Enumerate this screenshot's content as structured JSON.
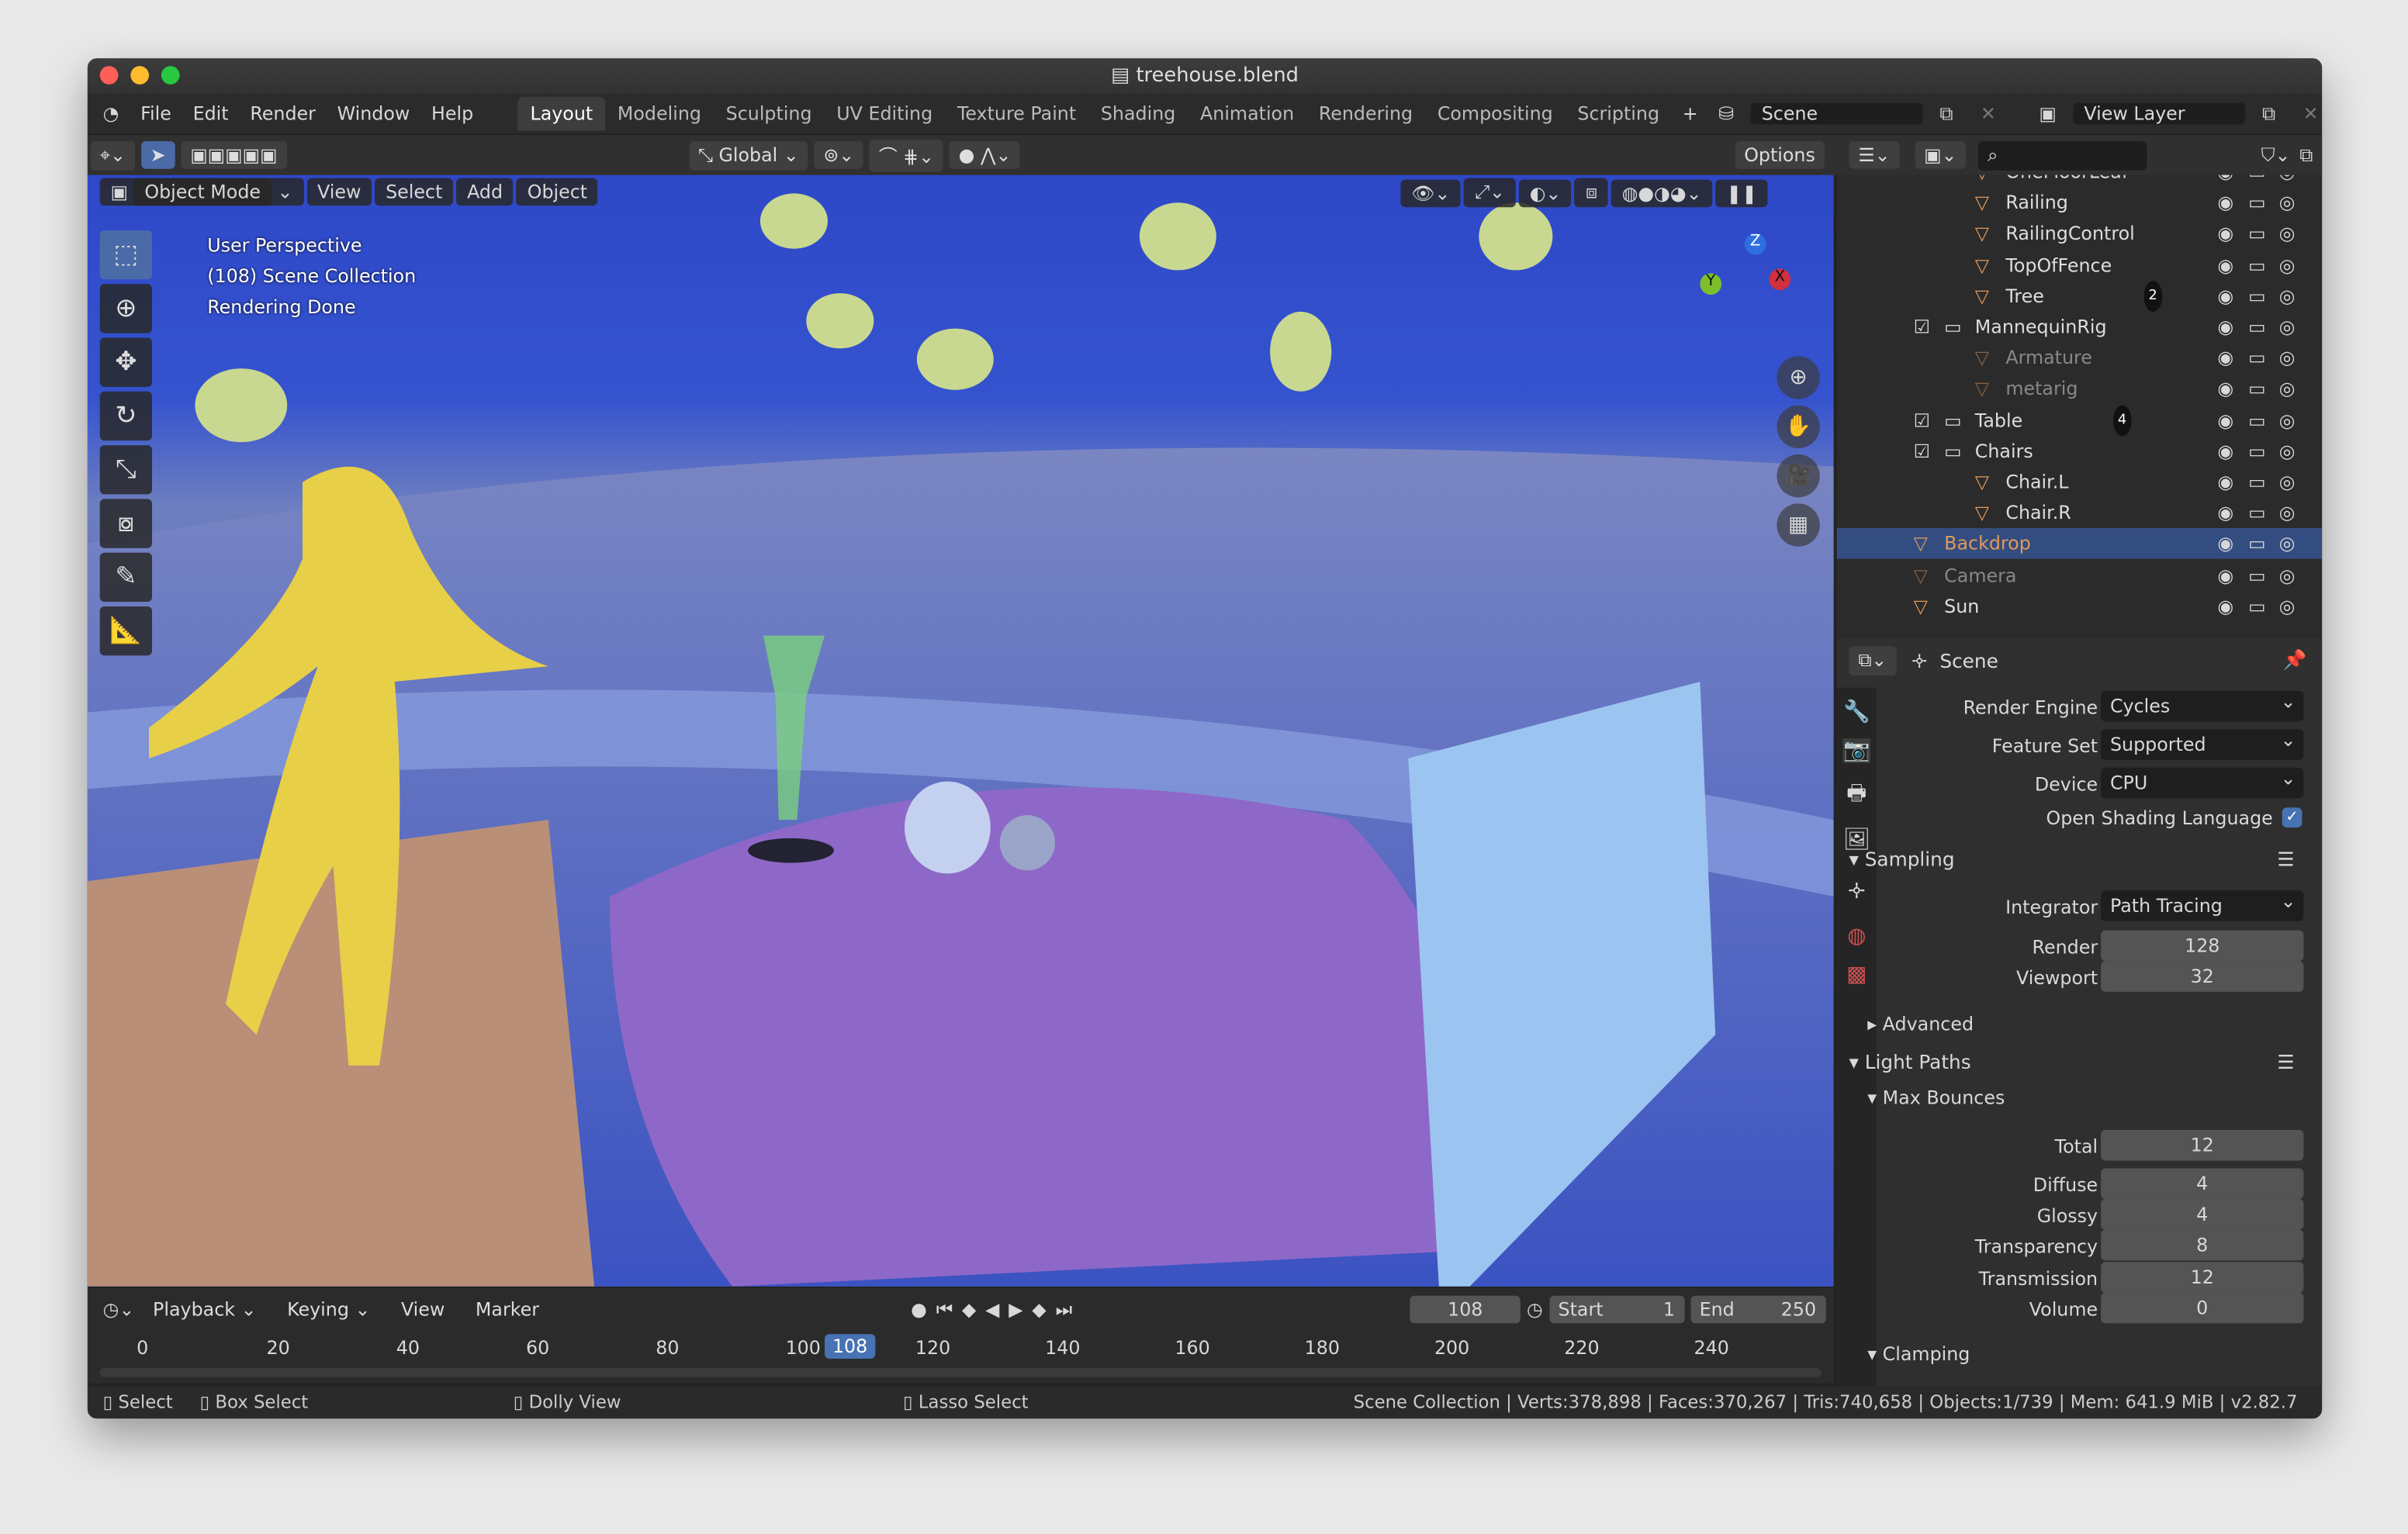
{
  "window": {
    "title": "treehouse.blend"
  },
  "menu": [
    "File",
    "Edit",
    "Render",
    "Window",
    "Help"
  ],
  "workspaces": [
    {
      "label": "Layout",
      "active": true
    },
    {
      "label": "Modeling"
    },
    {
      "label": "Sculpting"
    },
    {
      "label": "UV Editing"
    },
    {
      "label": "Texture Paint"
    },
    {
      "label": "Shading"
    },
    {
      "label": "Animation"
    },
    {
      "label": "Rendering"
    },
    {
      "label": "Compositing"
    },
    {
      "label": "Scripting"
    }
  ],
  "add_workspace": "+",
  "scene": "Scene",
  "view_layer": "View Layer",
  "toolbar": {
    "orientation": "Global",
    "options": "Options"
  },
  "viewport": {
    "mode": "Object Mode",
    "menus": [
      "View",
      "Select",
      "Add",
      "Object"
    ],
    "overlay": [
      "User Perspective",
      "(108) Scene Collection",
      "Rendering Done"
    ],
    "axes": {
      "x": "X",
      "y": "Y",
      "z": "Z"
    }
  },
  "timeline": {
    "menus": [
      "Playback",
      "Keying",
      "View",
      "Marker"
    ],
    "current": "108",
    "start_label": "Start",
    "start": "1",
    "end_label": "End",
    "end": "250",
    "ticks": [
      "0",
      "20",
      "40",
      "60",
      "80",
      "100",
      "120",
      "140",
      "160",
      "180",
      "200",
      "220",
      "240"
    ]
  },
  "status": {
    "select": "Select",
    "box_select": "Box Select",
    "dolly": "Dolly View",
    "lasso": "Lasso Select",
    "info": "Scene Collection | Verts:378,898 | Faces:370,267 | Tris:740,658 | Objects:1/739 | Mem: 641.9 MiB | v2.82.7"
  },
  "outliner": [
    {
      "name": "OneFloorLeaf",
      "depth": 2,
      "dim": false
    },
    {
      "name": "Railing",
      "depth": 2
    },
    {
      "name": "RailingControl",
      "depth": 2
    },
    {
      "name": "TopOfFence",
      "depth": 2
    },
    {
      "name": "Tree",
      "depth": 2,
      "badge": "2"
    },
    {
      "name": "MannequinRig",
      "depth": 1,
      "collection": true
    },
    {
      "name": "Armature",
      "depth": 2,
      "dim": true
    },
    {
      "name": "metarig",
      "depth": 2,
      "dim": true
    },
    {
      "name": "Table",
      "depth": 1,
      "collection": true,
      "badge": "4"
    },
    {
      "name": "Chairs",
      "depth": 1,
      "collection": true
    },
    {
      "name": "Chair.L",
      "depth": 2
    },
    {
      "name": "Chair.R",
      "depth": 2
    },
    {
      "name": "Backdrop",
      "depth": 0,
      "selected": true
    },
    {
      "name": "Camera",
      "depth": 0,
      "dim": true
    },
    {
      "name": "Sun",
      "depth": 0
    }
  ],
  "properties": {
    "context": "Scene",
    "render_engine_label": "Render Engine",
    "render_engine": "Cycles",
    "feature_set_label": "Feature Set",
    "feature_set": "Supported",
    "device_label": "Device",
    "device": "CPU",
    "osl_label": "Open Shading Language",
    "osl": true,
    "sampling": "Sampling",
    "integrator_label": "Integrator",
    "integrator": "Path Tracing",
    "render_label": "Render",
    "render": "128",
    "viewport_label": "Viewport",
    "viewport": "32",
    "advanced": "Advanced",
    "light_paths": "Light Paths",
    "max_bounces": "Max Bounces",
    "bounces": [
      {
        "label": "Total",
        "value": "12"
      },
      {
        "label": "Diffuse",
        "value": "4"
      },
      {
        "label": "Glossy",
        "value": "4"
      },
      {
        "label": "Transparency",
        "value": "8"
      },
      {
        "label": "Transmission",
        "value": "12"
      },
      {
        "label": "Volume",
        "value": "0"
      }
    ],
    "clamping": "Clamping"
  },
  "colors": {
    "accent": "#4772b3",
    "selected_row": "#334d80",
    "object_orange": "#e09a5a",
    "data_green": "#3fc0a0"
  }
}
